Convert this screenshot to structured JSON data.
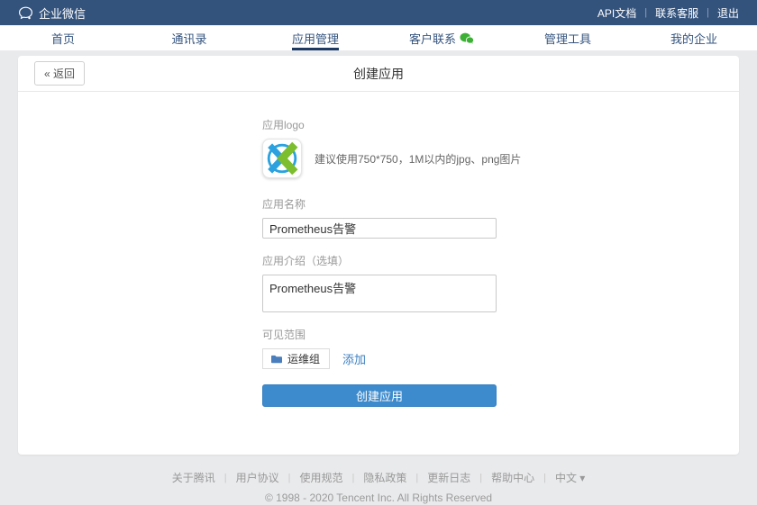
{
  "ui": {
    "separator": "|"
  },
  "colors": {
    "topbar_bg": "#33527C",
    "nav_text": "#35547E",
    "active_underline": "#1D3B62",
    "button_blue": "#3D8BCD",
    "link_blue": "#3E7FC1",
    "wechat_green": "#3CB035",
    "logo_blue": "#2BA2DF",
    "logo_green": "#7CBE2E",
    "folder_blue": "#4A7EBC"
  },
  "topbar": {
    "brand": "企业微信",
    "links": [
      {
        "label": "API文档"
      },
      {
        "label": "联系客服"
      },
      {
        "label": "退出"
      }
    ]
  },
  "nav": {
    "tabs": [
      {
        "label": "首页",
        "active": false
      },
      {
        "label": "通讯录",
        "active": false
      },
      {
        "label": "应用管理",
        "active": true
      },
      {
        "label": "客户联系",
        "active": false,
        "icon": "wechat-green-icon"
      },
      {
        "label": "管理工具",
        "active": false
      },
      {
        "label": "我的企业",
        "active": false
      }
    ]
  },
  "page": {
    "back_label": "« 返回",
    "title": "创建应用"
  },
  "form": {
    "logo_label": "应用logo",
    "logo_hint": "建议使用750*750，1M以内的jpg、png图片",
    "name_label": "应用名称",
    "name_value": "Prometheus告警",
    "desc_label": "应用介绍（选填）",
    "desc_value": "Prometheus告警",
    "scope_label": "可见范围",
    "scope_tag": "运维组",
    "add_label": "添加",
    "submit_label": "创建应用"
  },
  "footer": {
    "links": [
      "关于腾讯",
      "用户协议",
      "使用规范",
      "隐私政策",
      "更新日志",
      "帮助中心"
    ],
    "lang": "中文 ▾",
    "copyright": "© 1998 - 2020 Tencent Inc. All Rights Reserved"
  }
}
